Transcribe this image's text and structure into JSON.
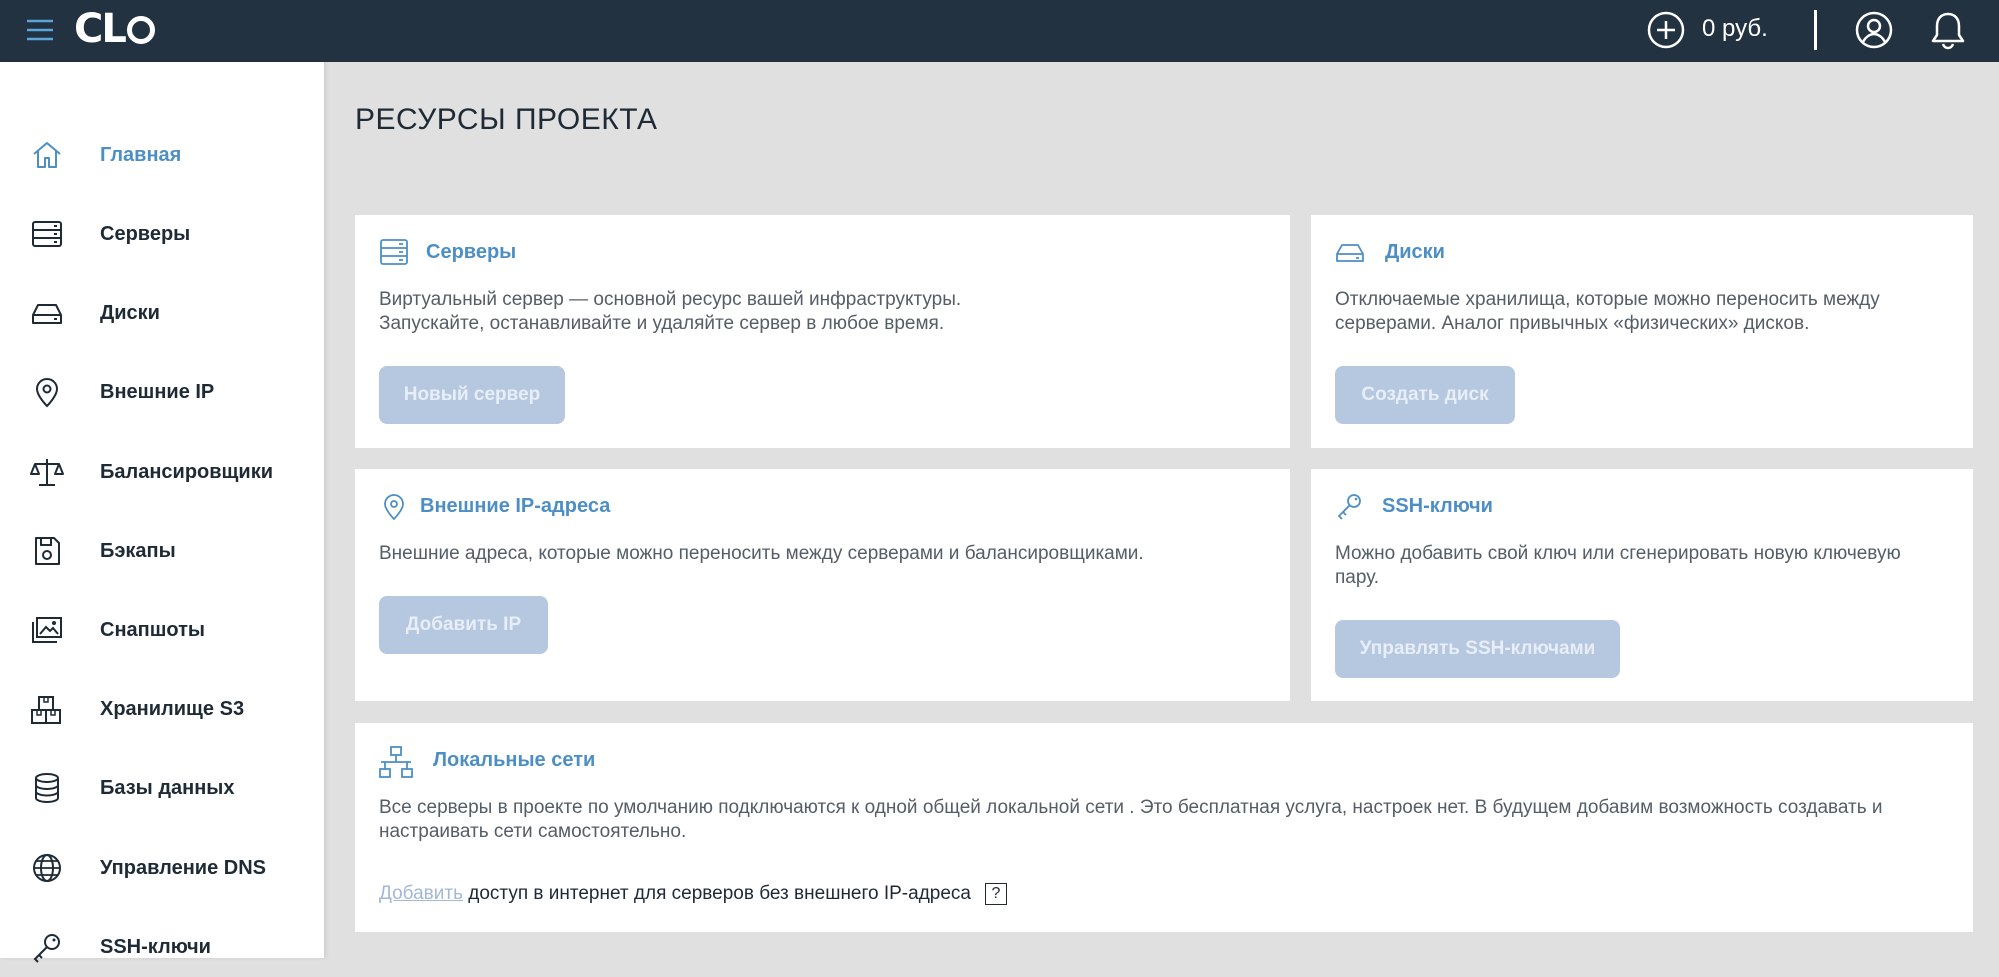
{
  "header": {
    "logo": "CLO",
    "balance": "0 руб."
  },
  "sidebar": {
    "items": [
      {
        "label": "Главная",
        "icon": "home-icon"
      },
      {
        "label": "Серверы",
        "icon": "server-icon"
      },
      {
        "label": "Диски",
        "icon": "disk-icon"
      },
      {
        "label": "Внешние IP",
        "icon": "location-pin-icon"
      },
      {
        "label": "Балансировщики",
        "icon": "scales-icon"
      },
      {
        "label": "Бэкапы",
        "icon": "backup-icon"
      },
      {
        "label": "Снапшоты",
        "icon": "snapshot-icon"
      },
      {
        "label": "Хранилище S3",
        "icon": "storage-icon"
      },
      {
        "label": "Базы данных",
        "icon": "database-icon"
      },
      {
        "label": "Управление DNS",
        "icon": "globe-icon"
      },
      {
        "label": "SSH-ключи",
        "icon": "key-icon"
      }
    ]
  },
  "main": {
    "title": "РЕСУРСЫ ПРОЕКТА",
    "cards": {
      "servers": {
        "title": "Серверы",
        "desc1": "Виртуальный сервер — основной ресурс вашей инфраструктуры.",
        "desc2": "Запускайте, останавливайте и удаляйте сервер в любое время.",
        "button": "Новый сервер"
      },
      "disks": {
        "title": "Диски",
        "desc1": "Отключаемые хранилища, которые можно переносить между",
        "desc2": "серверами. Аналог привычных «физических» дисков.",
        "button": "Создать диск"
      },
      "ips": {
        "title": "Внешние IP-адреса",
        "desc1": "Внешние адреса, которые можно переносить между серверами и балансировщиками.",
        "button": "Добавить IP"
      },
      "ssh": {
        "title": "SSH-ключи",
        "desc1": "Можно добавить свой ключ или сгенерировать новую ключевую",
        "desc2": "пару.",
        "button": "Управлять SSH-ключами"
      },
      "networks": {
        "title": "Локальные сети",
        "desc1": "Все серверы в проекте по умолчанию подключаются к одной общей локальной сети . Это бесплатная услуга, настроек нет. В будущем добавим возможность создавать и",
        "desc2": "настраивать сети самостоятельно.",
        "link": "Добавить",
        "note": " доступ в интернет для серверов без внешнего IP-адреса",
        "help": "?"
      }
    }
  },
  "colors": {
    "header_bg": "#233240",
    "accent": "#4d8fc4",
    "disabled_button": "#b6c7e0",
    "page_bg": "#e0e0e0"
  }
}
